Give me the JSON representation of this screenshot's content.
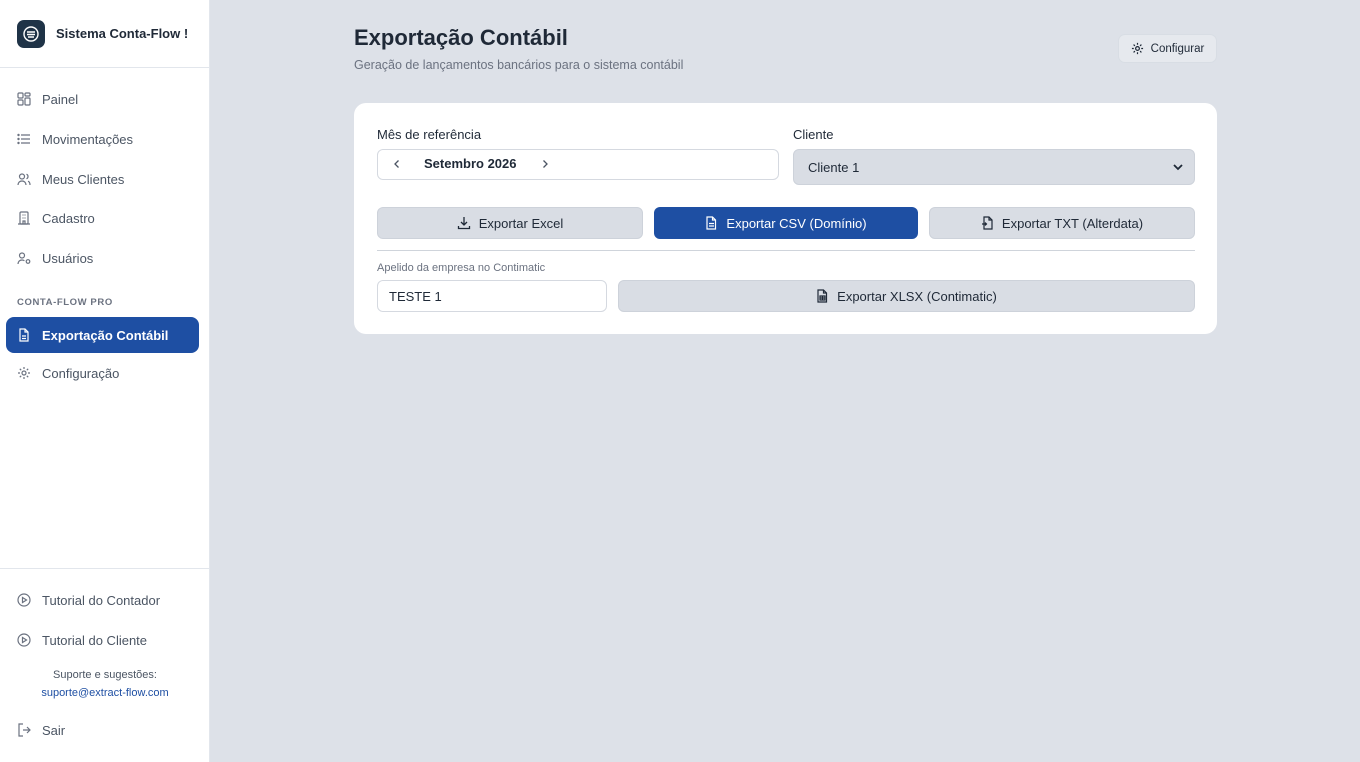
{
  "app": {
    "title": "Sistema Conta-Flow !"
  },
  "sidebar": {
    "items": [
      {
        "label": "Painel",
        "icon": "dashboard-icon"
      },
      {
        "label": "Movimentações",
        "icon": "list-icon"
      },
      {
        "label": "Meus Clientes",
        "icon": "users-icon"
      },
      {
        "label": "Cadastro",
        "icon": "building-icon"
      },
      {
        "label": "Usuários",
        "icon": "user-settings-icon"
      }
    ],
    "section_label": "CONTA-FLOW PRO",
    "pro_items": [
      {
        "label": "Exportação Contábil",
        "icon": "file-export-icon",
        "active": true
      },
      {
        "label": "Configuração",
        "icon": "gear-icon"
      }
    ],
    "bottom_items": [
      {
        "label": "Tutorial do Contador",
        "icon": "play-circle-icon"
      },
      {
        "label": "Tutorial do Cliente",
        "icon": "play-circle-icon"
      }
    ],
    "support_label": "Suporte e sugestões:",
    "support_email": "suporte@extract-flow.com",
    "logout_label": "Sair"
  },
  "header": {
    "title": "Exportação Contábil",
    "subtitle": "Geração de lançamentos bancários para o sistema contábil",
    "config_label": "Configurar"
  },
  "form": {
    "month_label": "Mês de referência",
    "month_value": "Setembro 2026",
    "client_label": "Cliente",
    "client_value": "Cliente 1",
    "export_excel": "Exportar Excel",
    "export_csv": "Exportar CSV (Domínio)",
    "export_txt": "Exportar TXT (Alterdata)",
    "nickname_label": "Apelido da empresa no Contimatic",
    "nickname_value": "TESTE 1",
    "export_xlsx": "Exportar XLSX (Contimatic)"
  },
  "colors": {
    "accent": "#1e4fa3",
    "background": "#dde1e8",
    "sidebar": "#ffffff"
  }
}
